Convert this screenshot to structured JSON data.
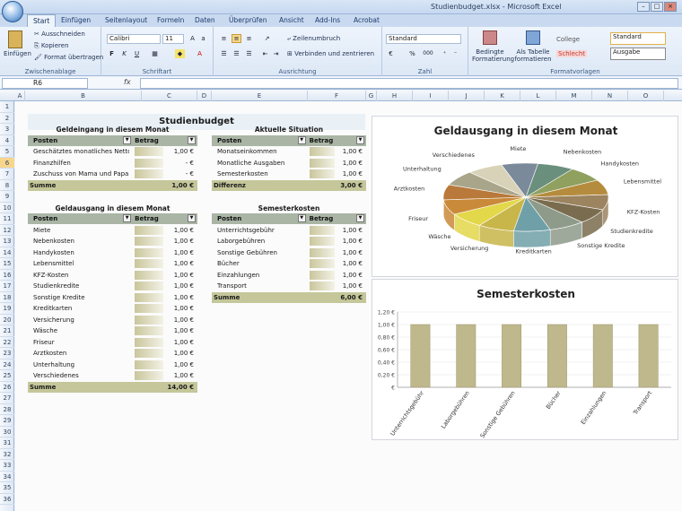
{
  "window": {
    "title": "Studienbudget.xlsx - Microsoft Excel"
  },
  "tabs": [
    "Start",
    "Einfügen",
    "Seitenlayout",
    "Formeln",
    "Daten",
    "Überprüfen",
    "Ansicht",
    "Add-Ins",
    "Acrobat"
  ],
  "ribbon": {
    "clipboard": {
      "paste": "Einfügen",
      "cut": "Ausschneiden",
      "copy": "Kopieren",
      "format_painter": "Format übertragen",
      "label": "Zwischenablage"
    },
    "font": {
      "name": "Calibri",
      "size": "11",
      "label": "Schriftart",
      "bold": "F",
      "italic": "K",
      "underline": "U"
    },
    "alignment": {
      "wrap": "Zeilenumbruch",
      "merge": "Verbinden und zentrieren",
      "label": "Ausrichtung"
    },
    "number": {
      "format": "Standard",
      "percent": "%",
      "thousands": "000",
      "label": "Zahl"
    },
    "styles": {
      "conditional": "Bedingte Formatierung",
      "as_table": "Als Tabelle formatieren",
      "college": "College",
      "standard": "Standard",
      "schlecht": "Schlecht",
      "ausgabe": "Ausgabe",
      "label": "Formatvorlagen"
    }
  },
  "formula_bar": {
    "cell_ref": "R6",
    "fx": "fx",
    "value": ""
  },
  "columns": [
    "A",
    "B",
    "C",
    "D",
    "E",
    "F",
    "G",
    "H",
    "I",
    "J",
    "K",
    "L",
    "M",
    "N",
    "O"
  ],
  "rows": [
    "1",
    "2",
    "3",
    "4",
    "5",
    "6",
    "7",
    "8",
    "9",
    "10",
    "11",
    "12",
    "13",
    "14",
    "15",
    "16",
    "17",
    "18",
    "19",
    "20",
    "21",
    "22",
    "23",
    "24",
    "25",
    "26",
    "27",
    "28",
    "29",
    "30",
    "31",
    "32",
    "33",
    "34",
    "35",
    "36"
  ],
  "selected_row": "6",
  "sheet": {
    "title": "Studienbudget",
    "income": {
      "title": "Geldeingang in diesem Monat",
      "col1": "Posten",
      "col2": "Betrag",
      "rows": [
        {
          "label": "Geschätztes monatliches Nettoeinkommen",
          "value": "1,00 €"
        },
        {
          "label": "Finanzhilfen",
          "value": "-   €"
        },
        {
          "label": "Zuschuss von Mama und Papa",
          "value": "-   €"
        }
      ],
      "sum_label": "Summe",
      "sum_value": "1,00 €"
    },
    "situation": {
      "title": "Aktuelle Situation",
      "col1": "Posten",
      "col2": "Betrag",
      "rows": [
        {
          "label": "Monatseinkommen",
          "value": "1,00 €"
        },
        {
          "label": "Monatliche Ausgaben",
          "value": "1,00 €"
        },
        {
          "label": "Semesterkosten",
          "value": "1,00 €"
        }
      ],
      "sum_label": "Differenz",
      "sum_value": "3,00 €"
    },
    "expenses": {
      "title": "Geldausgang in diesem Monat",
      "col1": "Posten",
      "col2": "Betrag",
      "rows": [
        {
          "label": "Miete",
          "value": "1,00 €"
        },
        {
          "label": "Nebenkosten",
          "value": "1,00 €"
        },
        {
          "label": "Handykosten",
          "value": "1,00 €"
        },
        {
          "label": "Lebensmittel",
          "value": "1,00 €"
        },
        {
          "label": "KFZ-Kosten",
          "value": "1,00 €"
        },
        {
          "label": "Studienkredite",
          "value": "1,00 €"
        },
        {
          "label": "Sonstige Kredite",
          "value": "1,00 €"
        },
        {
          "label": "Kreditkarten",
          "value": "1,00 €"
        },
        {
          "label": "Versicherung",
          "value": "1,00 €"
        },
        {
          "label": "Wäsche",
          "value": "1,00 €"
        },
        {
          "label": "Friseur",
          "value": "1,00 €"
        },
        {
          "label": "Arztkosten",
          "value": "1,00 €"
        },
        {
          "label": "Unterhaltung",
          "value": "1,00 €"
        },
        {
          "label": "Verschiedenes",
          "value": "1,00 €"
        }
      ],
      "sum_label": "Summe",
      "sum_value": "14,00 €"
    },
    "semester": {
      "title": "Semesterkosten",
      "col1": "Posten",
      "col2": "Betrag",
      "rows": [
        {
          "label": "Unterrichtsgebühr",
          "value": "1,00 €"
        },
        {
          "label": "Laborgebühren",
          "value": "1,00 €"
        },
        {
          "label": "Sonstige Gebühren",
          "value": "1,00 €"
        },
        {
          "label": "Bücher",
          "value": "1,00 €"
        },
        {
          "label": "Einzahlungen",
          "value": "1,00 €"
        },
        {
          "label": "Transport",
          "value": "1,00 €"
        }
      ],
      "sum_label": "Summe",
      "sum_value": "6,00 €"
    }
  },
  "chart_data": [
    {
      "type": "pie",
      "title": "Geldausgang in diesem Monat",
      "categories": [
        "Miete",
        "Nebenkosten",
        "Handykosten",
        "Lebensmittel",
        "KFZ-Kosten",
        "Studienkredite",
        "Sonstige Kredite",
        "Kreditkarten",
        "Versicherung",
        "Wäsche",
        "Friseur",
        "Arztkosten",
        "Unterhaltung",
        "Verschiedenes"
      ],
      "values": [
        1,
        1,
        1,
        1,
        1,
        1,
        1,
        1,
        1,
        1,
        1,
        1,
        1,
        1
      ],
      "colors": [
        "#7a8a9a",
        "#6b8f7d",
        "#8fa05f",
        "#b58c3e",
        "#9c8460",
        "#7a6c4e",
        "#8e9b8a",
        "#6fa0a8",
        "#c8b64a",
        "#e3d74a",
        "#c98a3a",
        "#b8793a",
        "#a8a58a",
        "#d8d2b8"
      ]
    },
    {
      "type": "bar",
      "title": "Semesterkosten",
      "categories": [
        "Unterrichtsgebühr",
        "Laborgebühren",
        "Sonstige Gebühren",
        "Bücher",
        "Einzahlungen",
        "Transport"
      ],
      "values": [
        1,
        1,
        1,
        1,
        1,
        1
      ],
      "ylim": [
        0,
        1.2
      ],
      "yticks": [
        "1,20 €",
        "1,00 €",
        "0,80 €",
        "0,60 €",
        "0,40 €",
        "0,20 €",
        "€"
      ],
      "color": "#bfb88c"
    }
  ]
}
